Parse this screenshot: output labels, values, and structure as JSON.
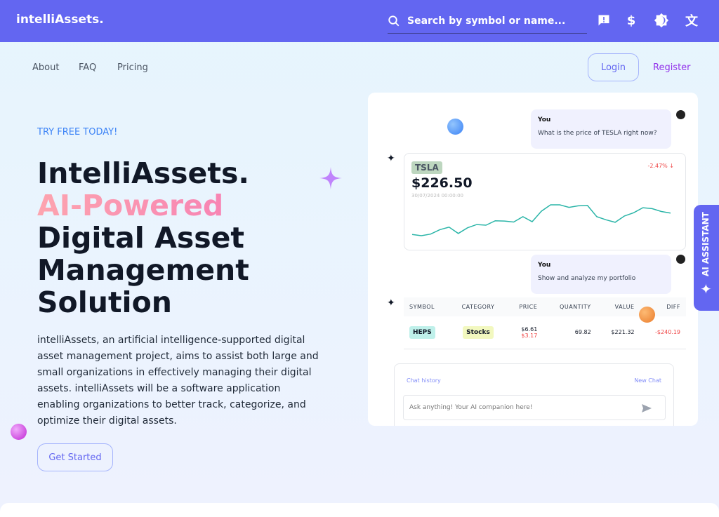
{
  "header": {
    "logo": "intelliAssets.",
    "search_placeholder": "Search by symbol or name...",
    "icons": [
      "feedback-icon",
      "dollar-icon",
      "theme-icon",
      "translate-icon"
    ],
    "color": "#6366f1"
  },
  "nav": {
    "items": [
      "About",
      "FAQ",
      "Pricing"
    ],
    "login": "Login",
    "register": "Register"
  },
  "hero": {
    "eyebrow": "TRY FREE TODAY!",
    "title_1": "IntelliAssets.",
    "title_2": "AI-Powered",
    "title_3": "Digital Asset Management Solution",
    "description": "intelliAssets, an artificial intelligence-supported digital asset management project, aims to assist both large and small organizations in effectively managing their digital assets. intelliAssets will be a software application enabling organizations to better track, categorize, and optimize their digital assets.",
    "cta": "Get Started"
  },
  "preview": {
    "msg1": {
      "author": "You",
      "text": "What is the price of TESLA right now?"
    },
    "stock": {
      "symbol": "TSLA",
      "price": "$226.50",
      "date": "30/07/2024 00:00:00",
      "change": "-2.47% ↓",
      "sparkline": [
        42,
        38,
        43,
        57,
        65,
        45,
        63,
        73,
        71,
        85,
        84,
        81,
        98,
        82,
        115,
        135,
        135,
        127,
        132,
        133,
        98,
        88,
        80,
        100,
        110,
        126,
        123,
        114,
        109
      ]
    },
    "msg2": {
      "author": "You",
      "text": "Show and analyze my portfolio"
    },
    "table": {
      "headers": [
        "SYMBOL",
        "CATEGORY",
        "PRICE",
        "QUANTITY",
        "VALUE",
        "DIFF"
      ],
      "row": {
        "symbol": "HEPS",
        "category": "Stocks",
        "price": "$6.61",
        "price2": "$3.17",
        "quantity": "69.82",
        "value": "$221.32",
        "diff": "-$240.19"
      }
    },
    "chat": {
      "history": "Chat history",
      "new_chat": "New Chat",
      "placeholder": "Ask anything! Your AI companion here!"
    }
  },
  "ai_tab": "AI ASSISTANT"
}
